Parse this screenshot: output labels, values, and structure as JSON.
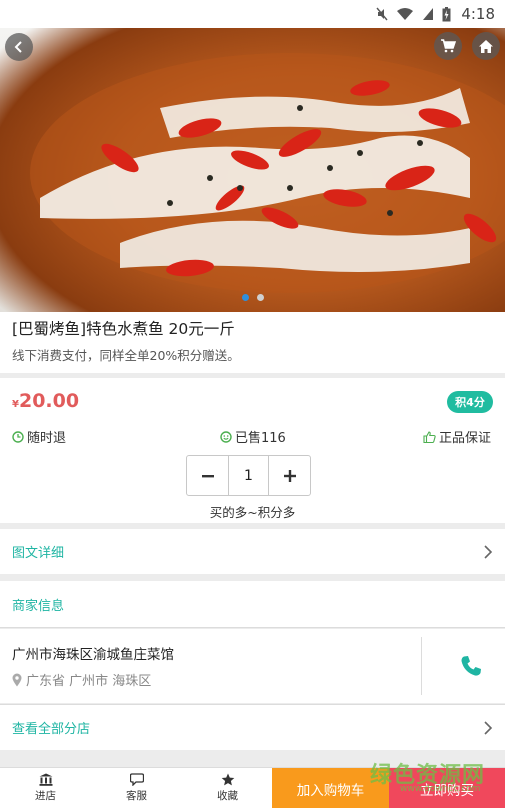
{
  "status_bar": {
    "time": "4:18"
  },
  "hero": {
    "slide_count": 2,
    "active_slide": 1
  },
  "product": {
    "title": "[巴蜀烤鱼]特色水煮鱼 20元一斤",
    "subtitle": "线下消费支付，同样全单20%积分赠送。",
    "currency": "¥",
    "price": "20.00",
    "points_badge": "积4分",
    "features": [
      "随时退",
      "已售116",
      "正品保证"
    ],
    "quantity": "1",
    "quantity_hint": "买的多~积分多"
  },
  "sections": {
    "detail": "图文详细",
    "merchant": "商家信息",
    "all_branches": "查看全部分店"
  },
  "merchant": {
    "name": "广州市海珠区渝城鱼庄菜馆",
    "location": "广东省 广州市 海珠区"
  },
  "bottom_bar": {
    "tabs": [
      "进店",
      "客服",
      "收藏"
    ],
    "add_to_cart": "加入购物车",
    "buy_now": "立即购买"
  },
  "watermark": {
    "text": "绿色资源网",
    "url": "www.downcc.com"
  },
  "colors": {
    "teal": "#1fb5a3",
    "price_red": "#e15b5b",
    "orange": "#f99a1c",
    "red": "#f0485c"
  }
}
